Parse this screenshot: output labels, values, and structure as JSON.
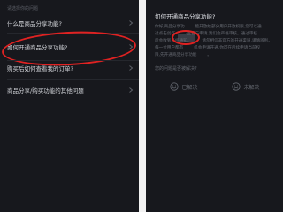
{
  "left": {
    "section_header": "请选择你的问题",
    "items": [
      {
        "label": "什么是商品分享功能?"
      },
      {
        "label": "如何开通商品分享功能?"
      },
      {
        "label": "购买后如何查看我的订单?"
      },
      {
        "label": "商品分享/购买功能的其他问题"
      }
    ],
    "highlight_color": "#e02222"
  },
  "right": {
    "title": "如何开通商品分享功能?",
    "body_lines": [
      [
        "你好,商品分享功",
        "能开放给部分用户开放权限,您可以通"
      ],
      [
        "过点击创作",
        "·查看与申请,我们会严格审核。通过审核"
      ],
      [
        "后会收到系统通知。",
        "请勿相信非官方的开通渠道,谨慎辨别。"
      ],
      [
        "每一位用户都有",
        "机会申请开通,你可在后续申请当前权"
      ],
      [
        "限,先开通商品分享功能",
        "。"
      ]
    ],
    "rating_question": "您的问题是否被解决?",
    "solved_label": "已解决",
    "unsolved_label": "未解决"
  },
  "colors": {
    "background": "#17181d",
    "highlight": "#e02222"
  }
}
